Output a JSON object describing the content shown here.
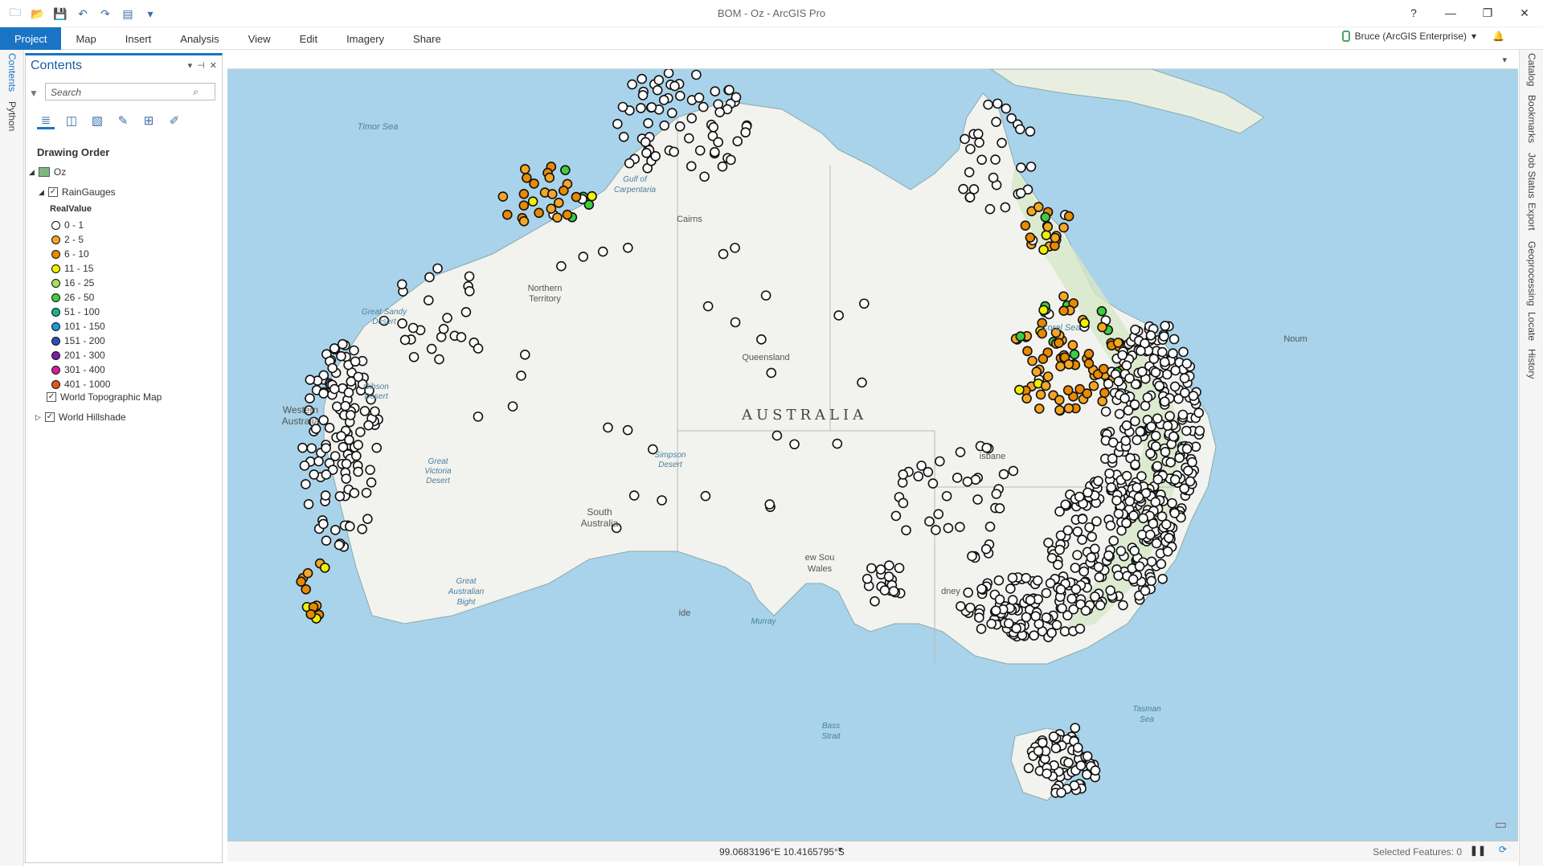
{
  "window": {
    "title": "BOM - Oz - ArcGIS Pro",
    "help": "?",
    "minimize": "—",
    "restore": "❐",
    "close": "✕"
  },
  "qat": [
    "🗀",
    "📂",
    "💾",
    "↶",
    "↷",
    "▤",
    "▾"
  ],
  "ribbon": {
    "tabs": [
      "Project",
      "Map",
      "Insert",
      "Analysis",
      "View",
      "Edit",
      "Imagery",
      "Share"
    ],
    "user": "Bruce (ArcGIS Enterprise)",
    "user_caret": "▾"
  },
  "left_tabs": [
    "Contents",
    "Python"
  ],
  "right_tabs": [
    "Catalog",
    "Bookmarks",
    "Job Status",
    "Export",
    "Geoprocessing",
    "Locate",
    "History"
  ],
  "contents": {
    "title": "Contents",
    "search_placeholder": "Search",
    "drawing_order": "Drawing Order",
    "map_name": "Oz",
    "layer1": "RainGauges",
    "field": "RealValue",
    "classes": [
      {
        "label": "0 - 1",
        "color": "#ffffff"
      },
      {
        "label": "2 - 5",
        "color": "#f5a623"
      },
      {
        "label": "6 - 10",
        "color": "#e88a00"
      },
      {
        "label": "11 - 15",
        "color": "#f0f000"
      },
      {
        "label": "16 - 25",
        "color": "#a5e05a"
      },
      {
        "label": "26 - 50",
        "color": "#3ccf3c"
      },
      {
        "label": "51 - 100",
        "color": "#12b58a"
      },
      {
        "label": "101 - 150",
        "color": "#1b9ad6"
      },
      {
        "label": "151 - 200",
        "color": "#2b4fbf"
      },
      {
        "label": "201 - 300",
        "color": "#7b1fa2"
      },
      {
        "label": "301 - 400",
        "color": "#d81b9a"
      },
      {
        "label": "401 - 1000",
        "color": "#e0581b"
      }
    ],
    "layer2": "World Topographic Map",
    "layer3": "World Hillshade"
  },
  "map": {
    "title": "AUSTRALIA",
    "labels": [
      {
        "text": "Timor Sea"
      },
      {
        "text": "Gulf of"
      },
      {
        "text": "Carpentaria"
      },
      {
        "text": "Cairns"
      },
      {
        "text": "Coral Sea"
      },
      {
        "text": "Great Sandy"
      },
      {
        "text": "Desert"
      },
      {
        "text": "Northern"
      },
      {
        "text": "Territory"
      },
      {
        "text": "Queensland"
      },
      {
        "text": "Gibson"
      },
      {
        "text": "Desert"
      },
      {
        "text": "Western"
      },
      {
        "text": "Australia"
      },
      {
        "text": "Simpson"
      },
      {
        "text": "Desert"
      },
      {
        "text": "Great"
      },
      {
        "text": "Victoria"
      },
      {
        "text": "Desert"
      },
      {
        "text": "South"
      },
      {
        "text": "Australia"
      },
      {
        "text": "Great"
      },
      {
        "text": "Australian"
      },
      {
        "text": "Bight"
      },
      {
        "text": "ew Sou"
      },
      {
        "text": "Wales"
      },
      {
        "text": "dney"
      },
      {
        "text": "isbane"
      },
      {
        "text": "ide"
      },
      {
        "text": "Murray"
      },
      {
        "text": "Bass"
      },
      {
        "text": "Strait"
      },
      {
        "text": "Tasman"
      },
      {
        "text": "Sea"
      },
      {
        "text": "Noum"
      }
    ]
  },
  "status": {
    "coords": "99.0683196°E 10.4165795°S",
    "selected": "Selected Features: 0"
  }
}
